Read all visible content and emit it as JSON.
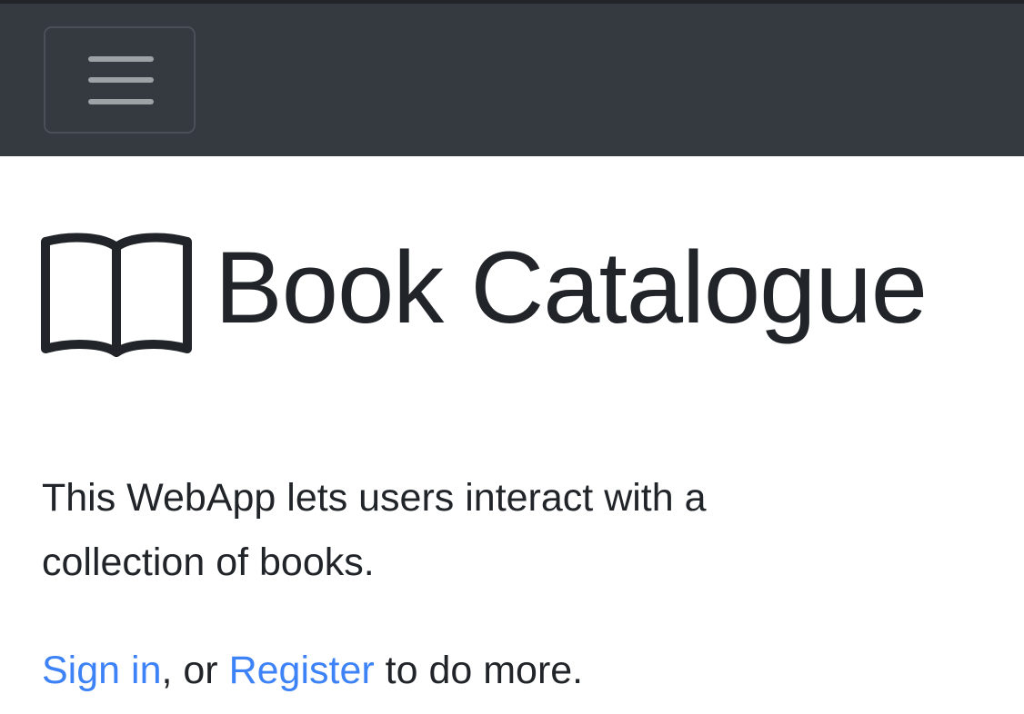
{
  "navbar": {
    "toggle_icon": "hamburger-menu-icon",
    "background": "#343a40"
  },
  "brand": {
    "icon": "open-book-icon",
    "title": "Book Catalogue"
  },
  "intro": {
    "text": "This WebApp lets users interact with a collection of books."
  },
  "cta": {
    "signin_label": "Sign in",
    "sep": ", or ",
    "register_label": "Register",
    "suffix": " to do more."
  },
  "colors": {
    "link": "#3d83f7",
    "text": "#212529"
  }
}
